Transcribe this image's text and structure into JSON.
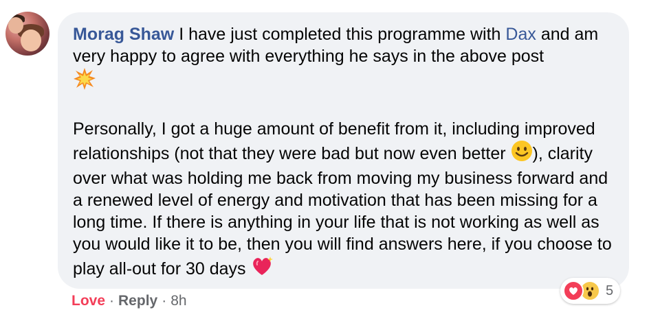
{
  "comment": {
    "author": "Morag Shaw",
    "text_part1": " I have just completed this programme with ",
    "mention": "Dax",
    "text_part2": " and am very happy to agree with everything he says in the above post",
    "para2_part1": "Personally, I got a huge amount of benefit from it, including improved relationships (not that they were bad but now even better ",
    "para2_part2": "), clarity over what was holding me back from moving my business forward and a renewed level of energy and motivation that has been missing for a long time. If there is anything in your life that is not working as well as you would like it to be, then you will find answers here, if you choose to play all-out for 30 days ",
    "emojis": [
      "collision-emoji",
      "smiling-face-emoji",
      "sparkling-heart-emoji"
    ]
  },
  "reactions": {
    "types": [
      "love",
      "wow"
    ],
    "count": "5"
  },
  "actions": {
    "love": "Love",
    "separator": "·",
    "reply": "Reply",
    "time": "8h"
  },
  "colors": {
    "author": "#385898",
    "bubble": "#f0f2f5",
    "love": "#f33e58",
    "meta": "#65676b"
  }
}
